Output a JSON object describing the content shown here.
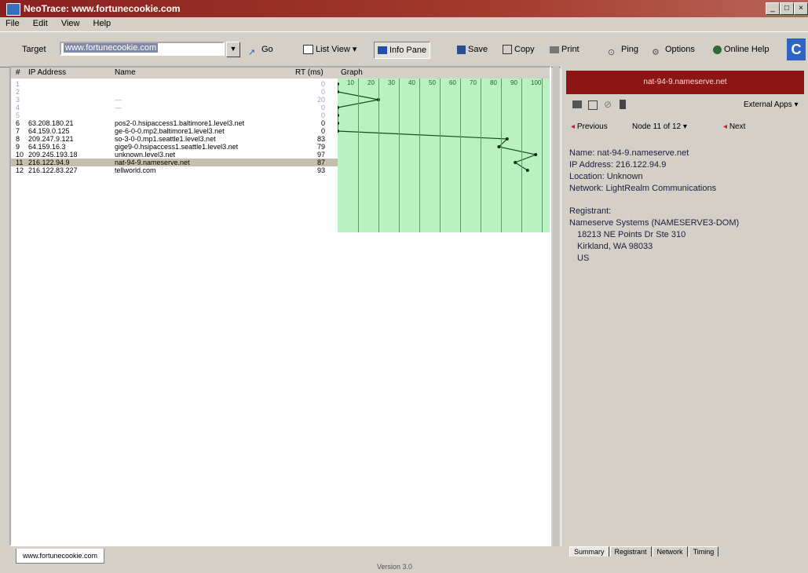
{
  "window": {
    "title": "NeoTrace: www.fortunecookie.com"
  },
  "menu": [
    "File",
    "Edit",
    "View",
    "Help"
  ],
  "toolbar": {
    "target_label": "Target",
    "target_value": "www.fortunecookie.com",
    "go": "Go",
    "list_view": "List View",
    "info_pane": "Info Pane",
    "save": "Save",
    "copy": "Copy",
    "print": "Print",
    "ping": "Ping",
    "options": "Options",
    "online_help": "Online Help"
  },
  "table": {
    "headers": {
      "num": "#",
      "ip": "IP Address",
      "name": "Name",
      "rt": "RT (ms)",
      "graph": "Graph"
    },
    "graph_ticks": [
      "10",
      "20",
      "30",
      "40",
      "50",
      "60",
      "70",
      "80",
      "90",
      "100"
    ],
    "rows": [
      {
        "num": "1",
        "ip": "",
        "name": "",
        "rt": "0",
        "rt_value": 0,
        "blurred": true
      },
      {
        "num": "2",
        "ip": "",
        "name": "",
        "rt": "0",
        "rt_value": 0,
        "blurred": true
      },
      {
        "num": "3",
        "ip": "",
        "name": "—",
        "rt": "20",
        "rt_value": 20,
        "blurred": true
      },
      {
        "num": "4",
        "ip": "",
        "name": "—",
        "rt": "0",
        "rt_value": 0,
        "blurred": true
      },
      {
        "num": "5",
        "ip": "",
        "name": "",
        "rt": "0",
        "rt_value": 0,
        "blurred": true
      },
      {
        "num": "6",
        "ip": "63.208.180.21",
        "name": "pos2-0.hsipaccess1.baltimore1.level3.net",
        "rt": "0",
        "rt_value": 0
      },
      {
        "num": "7",
        "ip": "64.159.0.125",
        "name": "ge-6-0-0.mp2.baltimore1.level3.net",
        "rt": "0",
        "rt_value": 0
      },
      {
        "num": "8",
        "ip": "209.247.9.121",
        "name": "so-3-0-0.mp1.seattle1.level3.net",
        "rt": "83",
        "rt_value": 83
      },
      {
        "num": "9",
        "ip": "64.159.16.3",
        "name": "gige9-0.hsipaccess1.seattle1.level3.net",
        "rt": "79",
        "rt_value": 79
      },
      {
        "num": "10",
        "ip": "209.245.193.18",
        "name": "unknown.level3.net",
        "rt": "97",
        "rt_value": 97
      },
      {
        "num": "11",
        "ip": "216.122.94.9",
        "name": "nat-94-9.nameserve.net",
        "rt": "87",
        "rt_value": 87,
        "selected": true
      },
      {
        "num": "12",
        "ip": "216.122.83.227",
        "name": "tellworld.com",
        "rt": "93",
        "rt_value": 93
      }
    ]
  },
  "left_tab": "www.fortunecookie.com",
  "version": "Version 3.0",
  "right": {
    "banner": "nat-94-9.nameserve.net",
    "external_apps": "External Apps",
    "previous": "Previous",
    "node_selector": "Node 11 of 12",
    "next": "Next",
    "info": {
      "name": "Name: nat-94-9.nameserve.net",
      "ip": "IP Address: 216.122.94.9",
      "location": "Location: Unknown",
      "network": "Network: LightRealm Communications",
      "registrant_label": "Registrant:",
      "registrant_org": "Nameserve Systems (NAMESERVE3-DOM)",
      "addr1": "18213 NE Points Dr Ste 310",
      "addr2": "Kirkland, WA 98033",
      "country": "US"
    },
    "tabs": [
      "Summary",
      "Registrant",
      "Network",
      "Timing"
    ]
  },
  "colors": {
    "title_bar": "#8a2020",
    "graph_bg": "#b9f2c0",
    "banner": "#8e1515",
    "selected_row": "#c5bdae"
  }
}
